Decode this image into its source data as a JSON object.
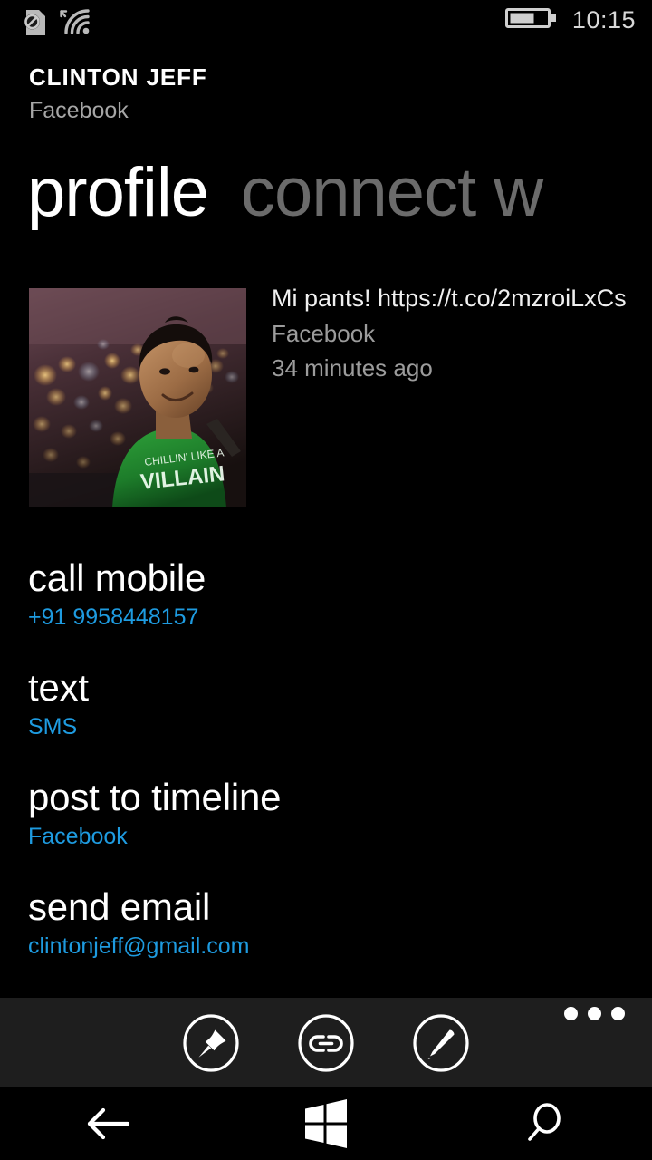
{
  "status_bar": {
    "icons": [
      {
        "name": "no-sim-icon",
        "label": "no SIM"
      },
      {
        "name": "wifi-icon",
        "label": "Wi-Fi connected"
      },
      {
        "name": "battery-icon",
        "label": "battery"
      }
    ],
    "battery_level_percent": 62,
    "time": "10:15"
  },
  "contact": {
    "name": "CLINTON JEFF",
    "source": "Facebook"
  },
  "pivot": {
    "items": [
      {
        "label": "profile",
        "active": true
      },
      {
        "label": "connect w",
        "active": false
      }
    ]
  },
  "post": {
    "photo_alt": "contact photo",
    "body": "Mi pants! https://t.co/2mzroiLxCs",
    "source": "Facebook",
    "time": "34 minutes ago"
  },
  "actions": [
    {
      "title": "call mobile",
      "sub": "+91 9958448157",
      "sub_color": "#1e9be0"
    },
    {
      "title": "text",
      "sub": "SMS",
      "sub_color": "#1e9be0"
    },
    {
      "title": "post to timeline",
      "sub": "Facebook",
      "sub_color": "#1e9be0"
    },
    {
      "title": "send email",
      "sub": "clintonjeff@gmail.com",
      "sub_color": "#1e9be0"
    }
  ],
  "appbar": {
    "buttons": [
      {
        "name": "pin-button",
        "icon": "pin-icon"
      },
      {
        "name": "link-button",
        "icon": "link-icon"
      },
      {
        "name": "edit-button",
        "icon": "pencil-icon"
      }
    ],
    "more_label": "..."
  },
  "navbar": {
    "buttons": [
      {
        "name": "back-button",
        "icon": "back-arrow-icon"
      },
      {
        "name": "start-button",
        "icon": "windows-logo-icon"
      },
      {
        "name": "search-button",
        "icon": "search-icon"
      }
    ]
  },
  "colors": {
    "background": "#000000",
    "accent": "#1e9be0",
    "appbar_background": "#1e1e1e",
    "secondary_text": "#9c9c9c",
    "inactive_pivot": "#6b6b6b"
  }
}
